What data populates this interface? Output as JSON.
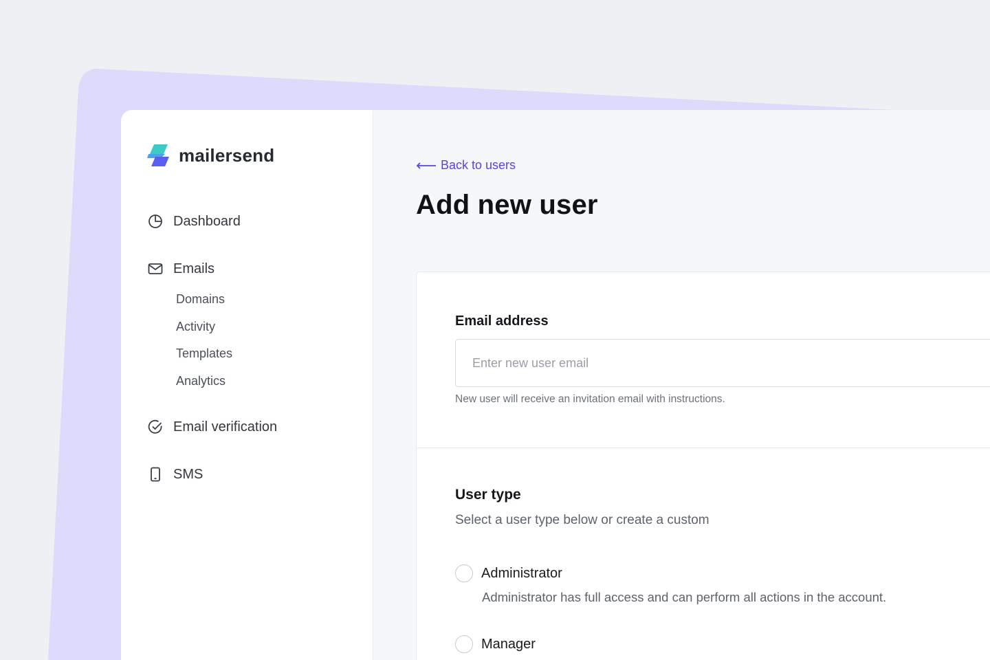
{
  "brand": {
    "name": "mailersend",
    "accent": "#5546e0",
    "logo_colors": [
      "#3ec9c9",
      "#5b5ff0"
    ]
  },
  "sidebar": {
    "items": [
      {
        "label": "Dashboard",
        "icon": "pie-chart-icon"
      },
      {
        "label": "Emails",
        "icon": "mail-icon",
        "children": [
          "Domains",
          "Activity",
          "Templates",
          "Analytics"
        ]
      },
      {
        "label": "Email verification",
        "icon": "check-circle-icon"
      },
      {
        "label": "SMS",
        "icon": "phone-icon"
      }
    ]
  },
  "main": {
    "back_link": "Back to users",
    "title": "Add new user",
    "email_section": {
      "label": "Email address",
      "placeholder": "Enter new user email",
      "value": "",
      "help": "New user will receive an invitation email with instructions."
    },
    "user_type_section": {
      "title": "User type",
      "subtitle": "Select a user type below or create a custom",
      "options": [
        {
          "label": "Administrator",
          "description": "Administrator has full access and can perform all actions in the account.",
          "selected": false
        },
        {
          "label": "Manager",
          "description": "",
          "selected": false
        }
      ]
    }
  }
}
